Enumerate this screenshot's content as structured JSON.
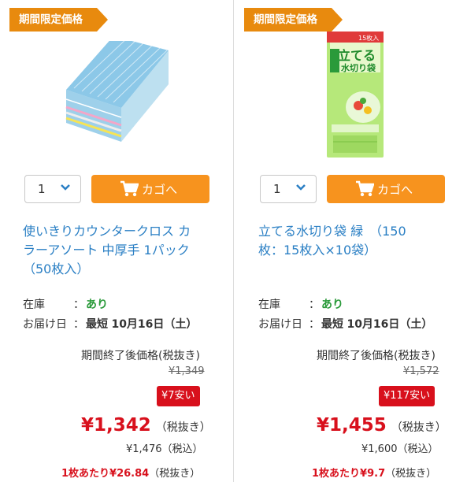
{
  "products": [
    {
      "badge": "期間限定価格",
      "quantity": "1",
      "cart_label": "カゴへ",
      "title_line1": "使いきりカウンタークロス カ",
      "title_line2": "ラーアソート 中厚手 1パック",
      "title_line3": "（50枚入）",
      "stock_key": "在庫",
      "stock_value": "あり",
      "delivery_key": "お届け日",
      "delivery_prefix": "最短",
      "delivery_value": "10月16日（土）",
      "after_label": "期間終了後価格(税抜き)",
      "old_price": "¥1,349",
      "save": "¥7安い",
      "price": "¥1,342",
      "price_note": "（税抜き）",
      "tax_in": "¥1,476（税込）",
      "per_unit_value": "1枚あたり¥26.84",
      "per_unit_note": "（税抜き）"
    },
    {
      "badge": "期間限定価格",
      "quantity": "1",
      "cart_label": "カゴへ",
      "title_line1": "立てる水切り袋 緑　（150",
      "title_line2": "枚：15枚入×10袋）",
      "title_line3": "",
      "stock_key": "在庫",
      "stock_value": "あり",
      "delivery_key": "お届け日",
      "delivery_prefix": "最短",
      "delivery_value": "10月16日（土）",
      "after_label": "期間終了後価格(税抜き)",
      "old_price": "¥1,572",
      "save": "¥117安い",
      "price": "¥1,455",
      "price_note": "（税抜き）",
      "tax_in": "¥1,600（税込）",
      "per_unit_value": "1枚あたり¥9.7",
      "per_unit_note": "（税抜き）"
    }
  ],
  "package_text": {
    "count": "15枚入",
    "brand": "立てる",
    "name": "水切り袋"
  },
  "colors": {
    "badge": "#e88a0e",
    "cart_button": "#f7931e",
    "link": "#2a7fc4",
    "price": "#d8101c",
    "stock": "#2a9a3a"
  }
}
